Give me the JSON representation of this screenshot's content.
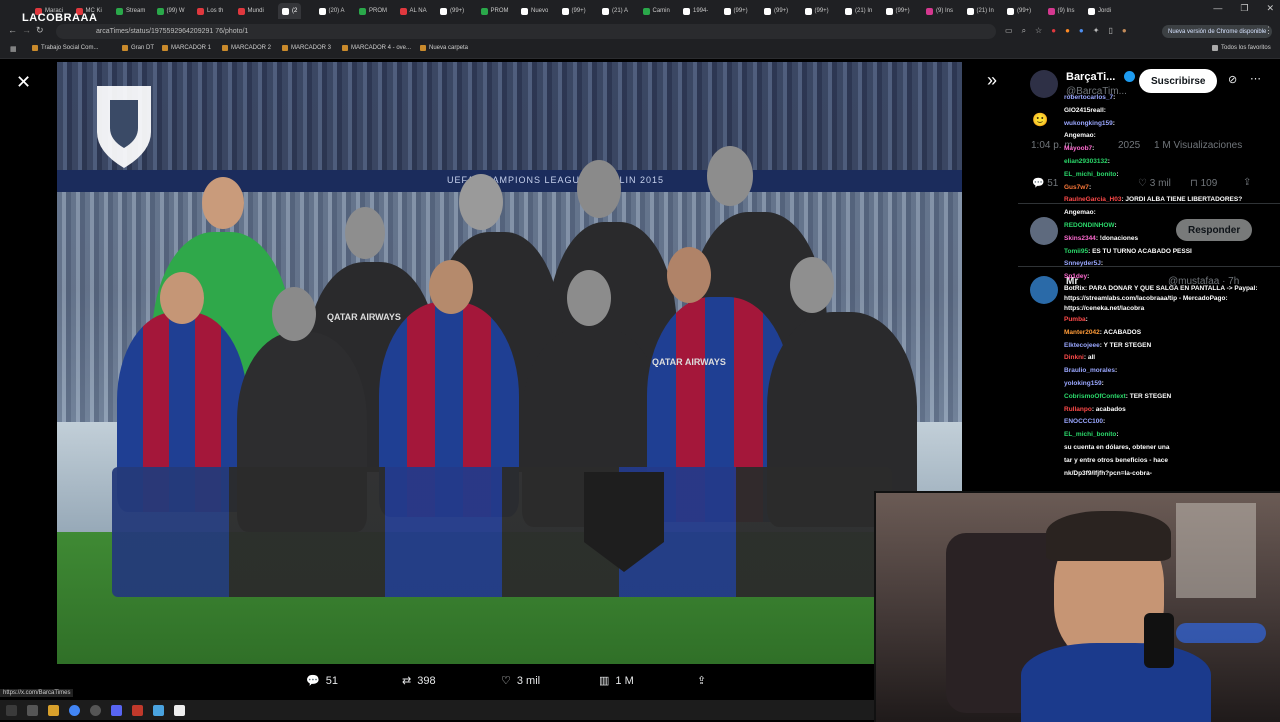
{
  "tabs": [
    {
      "label": "Maraci",
      "color": "#e0383e"
    },
    {
      "label": "MC Ki",
      "color": "#e0383e"
    },
    {
      "label": "Stream",
      "color": "#2aa84a"
    },
    {
      "label": "(99) W",
      "color": "#2aa84a"
    },
    {
      "label": "Los th",
      "color": "#e0383e"
    },
    {
      "label": "Mundi",
      "color": "#e0383e"
    },
    {
      "label": "(2",
      "color": "#ffffff",
      "active": true
    },
    {
      "label": "(20) A",
      "color": "#ffffff"
    },
    {
      "label": "PROM",
      "color": "#2aa84a"
    },
    {
      "label": "AL NA",
      "color": "#e0383e"
    },
    {
      "label": "(99+)",
      "color": "#ffffff"
    },
    {
      "label": "PROM",
      "color": "#2aa84a"
    },
    {
      "label": "Nuevo",
      "color": "#ffffff"
    },
    {
      "label": "(99+)",
      "color": "#ffffff"
    },
    {
      "label": "(21) A",
      "color": "#ffffff"
    },
    {
      "label": "Camin",
      "color": "#2aa84a"
    },
    {
      "label": "1994-",
      "color": "#ffffff"
    },
    {
      "label": "(99+)",
      "color": "#ffffff"
    },
    {
      "label": "(99+)",
      "color": "#ffffff"
    },
    {
      "label": "(99+)",
      "color": "#ffffff"
    },
    {
      "label": "(21) In",
      "color": "#ffffff"
    },
    {
      "label": "(99+)",
      "color": "#ffffff"
    },
    {
      "label": "(9) Ins",
      "color": "#d4388f"
    },
    {
      "label": "(21) In",
      "color": "#ffffff"
    },
    {
      "label": "(99+)",
      "color": "#ffffff"
    },
    {
      "label": "(9) Ins",
      "color": "#d4388f"
    },
    {
      "label": "Jordi",
      "color": "#ffffff"
    }
  ],
  "window_controls": [
    "—",
    "❐",
    "✕"
  ],
  "stream_overlay_name": "LACOBRAAA",
  "address": "arcaTimes/status/1975592964209291 76/photo/1",
  "update_button": "Nueva versión de Chrome disponible",
  "bookmarks": [
    {
      "label": "Trabajo Social Com..."
    },
    {
      "label": "Gran DT"
    },
    {
      "label": "MARCADOR 1"
    },
    {
      "label": "MARCADOR 2"
    },
    {
      "label": "MARCADOR 3"
    },
    {
      "label": "MARCADOR 4 - ove..."
    },
    {
      "label": "Nueva carpeta"
    }
  ],
  "bookmarks_right": "Todos los favoritos",
  "photo_banner": "UEFA CHAMPIONS LEAGUE · BERLIN 2015",
  "sponsor": "QATAR AIRWAYS",
  "actions": {
    "replies": "51",
    "reposts": "398",
    "likes": "3 mil",
    "views": "1 M"
  },
  "account": {
    "name": "BarçaTi...",
    "handle": "@BarcaTim...",
    "subscribe": "Suscribirse",
    "time": "1:04 p. m.",
    "year": "2025",
    "views": "1 M Visualizaciones",
    "replies": "51",
    "likes": "3 mil",
    "bookmarks": "109",
    "reply_button": "Responder",
    "next_user": "Mr",
    "next_handle": "@mustafaa · 7h"
  },
  "chat": [
    {
      "user": "robertocarlos_7",
      "msg": ":",
      "color": "#9aa7ff"
    },
    {
      "user": "GIO2415reall",
      "msg": ":",
      "color": "#ffffff"
    },
    {
      "user": "wukongking159",
      "msg": ":",
      "color": "#9aa7ff"
    },
    {
      "user": "Angemao",
      "msg": ":",
      "color": "#ffffff"
    },
    {
      "user": "Mayoob7",
      "msg": ":",
      "color": "#ff6bd1"
    },
    {
      "user": "elian29303132",
      "msg": ":",
      "color": "#2bd96b"
    },
    {
      "user": "EL_michi_bonito",
      "msg": ":",
      "color": "#2bd96b"
    },
    {
      "user": "Gus7w7",
      "msg": ":",
      "color": "#ff7a3a"
    },
    {
      "user": "RaulneGarcia_H03",
      "msg": ": JORDI ALBA TIENE LIBERTADORES?",
      "color": "#ff4a4a"
    },
    {
      "user": "Angemao",
      "msg": ":",
      "color": "#ffffff"
    },
    {
      "user": "REDONDINHOW",
      "msg": ":",
      "color": "#2bd96b"
    },
    {
      "user": "Skins2344",
      "msg": ": !donaciones",
      "color": "#ff6bd1"
    },
    {
      "user": "Tomii95",
      "msg": ": ES TU TURNO ACABADO PESSI",
      "color": "#2bd96b"
    },
    {
      "user": "Snneyder5J",
      "msg": ":",
      "color": "#9aa7ff"
    },
    {
      "user": "Sp1dey",
      "msg": ":",
      "color": "#ff6bd1"
    },
    {
      "user": "BotRix",
      "msg": ": PARA DONAR Y QUE SALGA EN PANTALLA -> Paypal: https://streamlabs.com/lacobraaa/tip - MercadoPago: https://ceneka.net/lacobra",
      "color": "#ffffff"
    },
    {
      "user": "Pumba",
      "msg": ":",
      "color": "#ff4a4a"
    },
    {
      "user": "Manter2042",
      "msg": ": ACABADOS",
      "color": "#ff9b38"
    },
    {
      "user": "Elktecojeee",
      "msg": ": Y TER STEGEN",
      "color": "#9aa7ff"
    },
    {
      "user": "Dinkni",
      "msg": ": all",
      "color": "#ff4a4a"
    },
    {
      "user": "Braulio_morales",
      "msg": ":",
      "color": "#9aa7ff"
    },
    {
      "user": "yoloking159",
      "msg": ":",
      "color": "#9aa7ff"
    },
    {
      "user": "CobrismoOfContext",
      "msg": ": TER STEGEN",
      "color": "#2bd96b"
    },
    {
      "user": "Rullanpo",
      "msg": ": acabados",
      "color": "#ff4a4a"
    },
    {
      "user": "ENOCCC100",
      "msg": ":",
      "color": "#9aa7ff"
    },
    {
      "user": "EL_michi_bonito",
      "msg": ":",
      "color": "#2bd96b"
    },
    {
      "user": "",
      "msg": "su cuenta en dólares, obtener una",
      "color": "#ffffff"
    },
    {
      "user": "",
      "msg": "tar y entre otros beneficios - hace",
      "color": "#ffffff"
    },
    {
      "user": "",
      "msg": "nk/Dp3f9/lfjfh?pcn=la-cobra-",
      "color": "#ffffff"
    }
  ],
  "status_url": "https://x.com/BarcaTimes",
  "colors": {
    "barca_blue": "#1f3f93",
    "barca_red": "#a4173a",
    "keeper_green": "#2fa84a",
    "x_blue": "#1d9bf0"
  }
}
